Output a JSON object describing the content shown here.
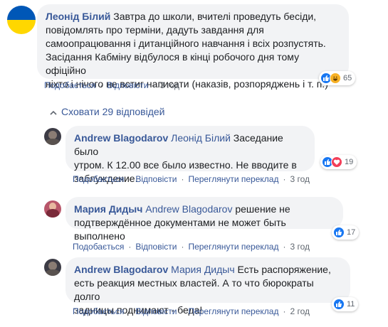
{
  "comment1": {
    "author": "Леонід Білий",
    "line1": "Завтра до школи, вчителі проведуть бесіди,",
    "line2": "повідомлять про терміни, дадуть завдання для",
    "line3": "самоопрацювання і дитанційного навчання і всіх розпустять.",
    "line4": "Засідання Кабміну відбулося в кінці робочого дня тому офіційно",
    "line5": "ніхто і нічого не встиг написати (наказів, розпоряджень і т. п.)",
    "reaction_count": "65",
    "like": "Подобається",
    "reply": "Відповісти",
    "time": "3 год"
  },
  "toggle_replies": "Сховати 29 відповідей",
  "reply1": {
    "author": "Andrew Blagodarov",
    "mention": "Леонід Білий",
    "line1_rest": " Заседание было",
    "line2": "утром. К 12.00 все было известно. Не вводите в",
    "line3": "заблуждение.",
    "reaction_count": "19",
    "like": "Подобається",
    "reply": "Відповісти",
    "translate": "Переглянути переклад",
    "time": "3 год"
  },
  "reply2": {
    "author": "Мария Дидыч",
    "mention": "Andrew Blagodarov",
    "line1_rest": " решение не",
    "line2": "подтверждённое документами не может быть выполнено",
    "reaction_count": "17",
    "like": "Подобається",
    "reply": "Відповісти",
    "translate": "Переглянути переклад",
    "time": "3 год"
  },
  "reply3": {
    "author": "Andrew Blagodarov",
    "mention": "Мария Дидыч",
    "line1_rest": " Есть распоряжение,",
    "line2": "есть реакция местных властей. А то что бюрократы долго",
    "line3": "задницы поднимают - беда!",
    "reaction_count": "11",
    "like": "Подобається",
    "reply": "Відповісти",
    "translate": "Переглянути переклад",
    "time": "2 год"
  },
  "colors": {
    "link": "#385898",
    "bubble": "#f2f3f5",
    "like_blue": "#1877f2",
    "love_red": "#f33e58",
    "haha_yellow": "#f7b125",
    "flag_blue": "#0057b7",
    "flag_yellow": "#ffd700"
  },
  "icons": [
    "like-icon",
    "love-icon",
    "haha-icon",
    "chevron-up-icon"
  ]
}
